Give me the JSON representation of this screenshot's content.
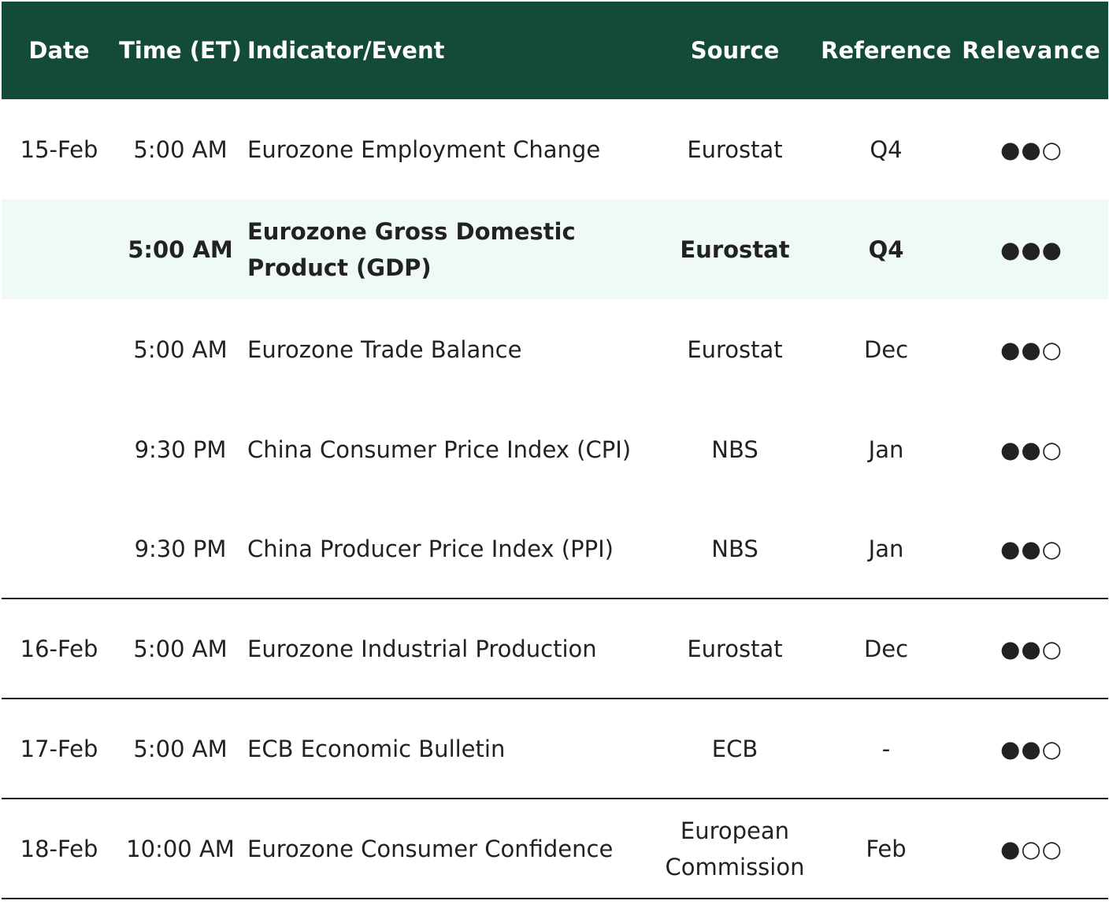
{
  "header": {
    "date": "Date",
    "time": "Time (ET)",
    "event": "Indicator/Event",
    "source": "Source",
    "reference": "Reference",
    "relevance": "Relevance"
  },
  "rows": [
    {
      "date": "15-Feb",
      "time": "5:00 AM",
      "event": "Eurozone Employment Change",
      "source": "Eurostat",
      "reference": "Q4",
      "relevance": "●●○"
    },
    {
      "date": "",
      "time": "5:00 AM",
      "event": "Eurozone Gross Domestic Product (GDP)",
      "source": "Eurostat",
      "reference": "Q4",
      "relevance": "●●●"
    },
    {
      "date": "",
      "time": "5:00 AM",
      "event": "Eurozone Trade Balance",
      "source": "Eurostat",
      "reference": "Dec",
      "relevance": "●●○"
    },
    {
      "date": "",
      "time": "9:30 PM",
      "event": "China Consumer Price Index (CPI)",
      "source": "NBS",
      "reference": "Jan",
      "relevance": "●●○"
    },
    {
      "date": "",
      "time": "9:30 PM",
      "event": "China Producer Price Index (PPI)",
      "source": "NBS",
      "reference": "Jan",
      "relevance": "●●○"
    },
    {
      "date": "16-Feb",
      "time": "5:00 AM",
      "event": "Eurozone Industrial Production",
      "source": "Eurostat",
      "reference": "Dec",
      "relevance": "●●○"
    },
    {
      "date": "17-Feb",
      "time": "5:00 AM",
      "event": "ECB Economic Bulletin",
      "source": "ECB",
      "reference": "-",
      "relevance": "●●○"
    },
    {
      "date": "18-Feb",
      "time": "10:00 AM",
      "event": "Eurozone Consumer Confidence",
      "source": "European Commission",
      "reference": "Feb",
      "relevance": "●○○"
    }
  ],
  "colors": {
    "header_bg": "#134b37",
    "highlight_bg": "#effaf5"
  }
}
